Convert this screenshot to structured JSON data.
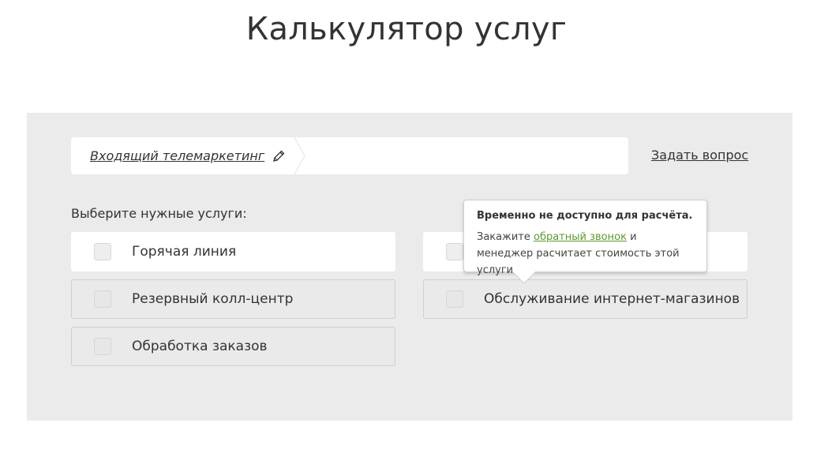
{
  "page": {
    "title": "Калькулятор услуг"
  },
  "breadcrumb": {
    "current": "Входящий телемаркетинг",
    "edit_icon": "pencil-icon"
  },
  "ask_question_label": "Задать вопрос",
  "services_label": "Выберите нужные услуги:",
  "services": [
    {
      "label": "Горячая линия",
      "checked": false,
      "available": true
    },
    {
      "label": "",
      "checked": false,
      "available": false
    },
    {
      "label": "Резервный колл-центр",
      "checked": false,
      "available": false
    },
    {
      "label": "Обслуживание интернет-магазинов",
      "checked": false,
      "available": false
    },
    {
      "label": "Обработка заказов",
      "checked": false,
      "available": false
    }
  ],
  "tooltip": {
    "title": "Временно не доступно для расчёта.",
    "text_before": "Закажите ",
    "link": "обратный звонок",
    "text_after": " и менеджер расчитает стоимость этой услуги."
  },
  "colors": {
    "panel_bg": "#ebebeb",
    "link_green": "#5a9a2f",
    "text": "#333333"
  }
}
